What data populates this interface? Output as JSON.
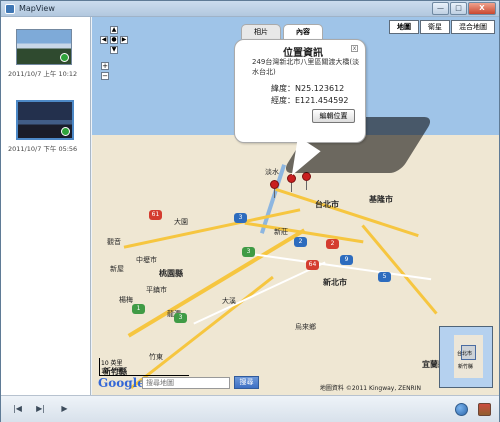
{
  "window": {
    "title": "MapView",
    "controls": {
      "minimize": "—",
      "maximize": "□",
      "close": "X"
    }
  },
  "sidebar": {
    "items": [
      {
        "caption": "2011/10/7 上午 10:12"
      },
      {
        "caption": "2011/10/7 下午 05:56"
      }
    ]
  },
  "map": {
    "types": {
      "map": "地圖",
      "satellite": "衛星",
      "hybrid": "混合地圖"
    },
    "nav": {
      "up": "▲",
      "left": "◀",
      "center": "●",
      "right": "▶",
      "down": "▼",
      "zoom_in": "+",
      "zoom_out": "−"
    },
    "labels": {
      "taipei": "台北市",
      "new_taipei": "新北市",
      "keelung": "基隆市",
      "xinzhuang": "新莊",
      "danshui": "淡水",
      "taoyuan": "桃園縣",
      "hsinchu": "新竹縣",
      "yilan": "宜蘭縣",
      "wulai": "烏來鄉",
      "dayuan": "大園",
      "daxi": "大溪",
      "zhongli": "中壢市",
      "pingzhen": "平鎮市",
      "yangmei": "楊梅",
      "longtan": "龍潭",
      "guanyin": "觀音",
      "xinwu": "新屋",
      "zhudong": "竹東"
    },
    "routes": [
      "61",
      "3",
      "1",
      "5",
      "2",
      "3",
      "2",
      "64",
      "9",
      "3"
    ],
    "scale": {
      "top": "10 英里",
      "bottom": "10 公里"
    },
    "google": "Google",
    "search_placeholder": "搜尋地圖",
    "search_button": "搜尋",
    "copyright": "地圖資料 ©2011 Kingway, ZENRIN",
    "overview": {
      "label1": "台北市",
      "label2": "新竹縣"
    }
  },
  "info_window": {
    "tabs": [
      "相片",
      "內容"
    ],
    "title": "位置資訊",
    "address": "249台灣新北市八里區關渡大橋(淡水台北)",
    "latitude": "緯度：N25.123612",
    "longitude": "經度：E121.454592",
    "edit_button": "編輯位置",
    "close": "x"
  },
  "bottombar": {
    "prev": "|◀",
    "next": "▶|",
    "play": "▶"
  },
  "colors": {
    "accent": "#3f77b5",
    "sea": "#9fc4e8",
    "road": "#f6c640",
    "pin": "#c91f1f"
  }
}
